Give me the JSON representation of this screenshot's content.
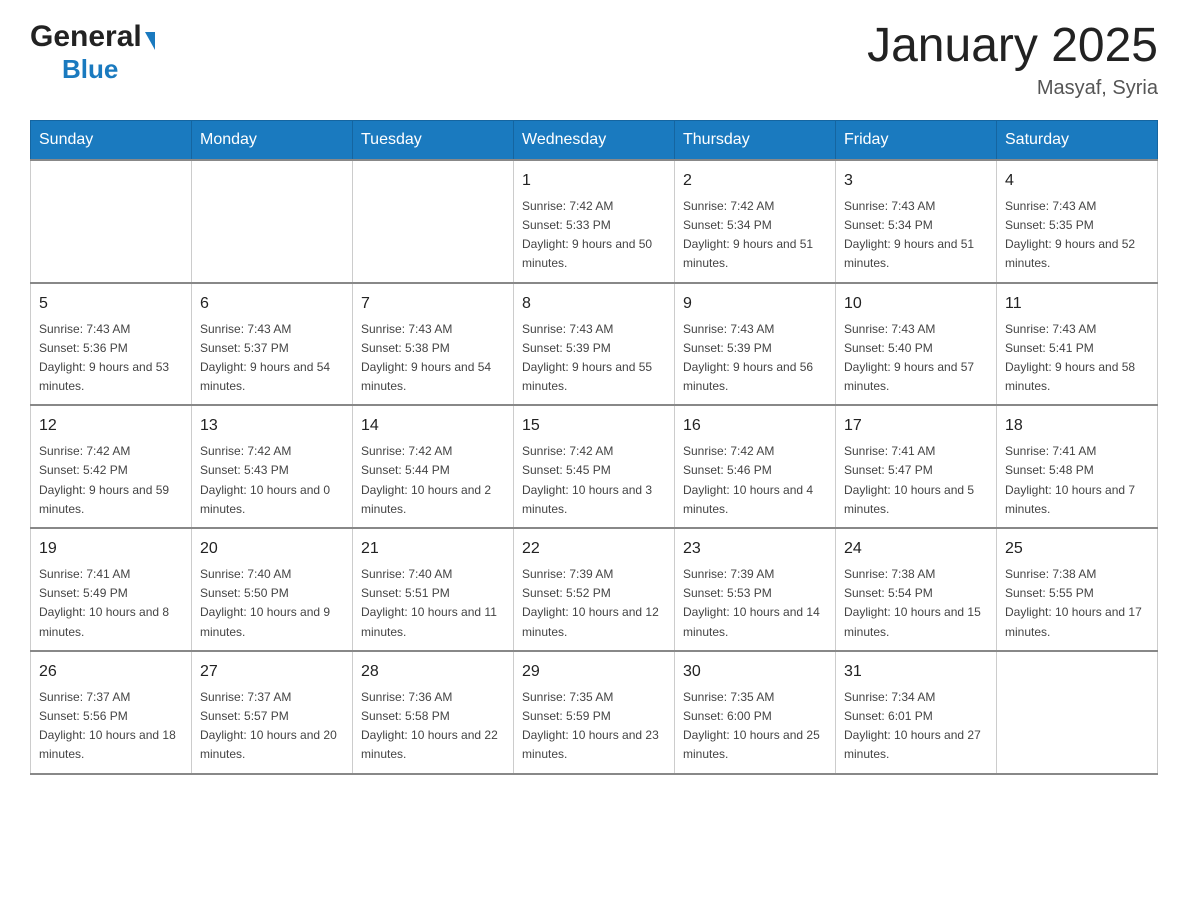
{
  "header": {
    "logo_general": "General",
    "logo_blue": "Blue",
    "month_title": "January 2025",
    "location": "Masyaf, Syria"
  },
  "days_of_week": [
    "Sunday",
    "Monday",
    "Tuesday",
    "Wednesday",
    "Thursday",
    "Friday",
    "Saturday"
  ],
  "weeks": [
    [
      {
        "day": "",
        "sunrise": "",
        "sunset": "",
        "daylight": ""
      },
      {
        "day": "",
        "sunrise": "",
        "sunset": "",
        "daylight": ""
      },
      {
        "day": "",
        "sunrise": "",
        "sunset": "",
        "daylight": ""
      },
      {
        "day": "1",
        "sunrise": "Sunrise: 7:42 AM",
        "sunset": "Sunset: 5:33 PM",
        "daylight": "Daylight: 9 hours and 50 minutes."
      },
      {
        "day": "2",
        "sunrise": "Sunrise: 7:42 AM",
        "sunset": "Sunset: 5:34 PM",
        "daylight": "Daylight: 9 hours and 51 minutes."
      },
      {
        "day": "3",
        "sunrise": "Sunrise: 7:43 AM",
        "sunset": "Sunset: 5:34 PM",
        "daylight": "Daylight: 9 hours and 51 minutes."
      },
      {
        "day": "4",
        "sunrise": "Sunrise: 7:43 AM",
        "sunset": "Sunset: 5:35 PM",
        "daylight": "Daylight: 9 hours and 52 minutes."
      }
    ],
    [
      {
        "day": "5",
        "sunrise": "Sunrise: 7:43 AM",
        "sunset": "Sunset: 5:36 PM",
        "daylight": "Daylight: 9 hours and 53 minutes."
      },
      {
        "day": "6",
        "sunrise": "Sunrise: 7:43 AM",
        "sunset": "Sunset: 5:37 PM",
        "daylight": "Daylight: 9 hours and 54 minutes."
      },
      {
        "day": "7",
        "sunrise": "Sunrise: 7:43 AM",
        "sunset": "Sunset: 5:38 PM",
        "daylight": "Daylight: 9 hours and 54 minutes."
      },
      {
        "day": "8",
        "sunrise": "Sunrise: 7:43 AM",
        "sunset": "Sunset: 5:39 PM",
        "daylight": "Daylight: 9 hours and 55 minutes."
      },
      {
        "day": "9",
        "sunrise": "Sunrise: 7:43 AM",
        "sunset": "Sunset: 5:39 PM",
        "daylight": "Daylight: 9 hours and 56 minutes."
      },
      {
        "day": "10",
        "sunrise": "Sunrise: 7:43 AM",
        "sunset": "Sunset: 5:40 PM",
        "daylight": "Daylight: 9 hours and 57 minutes."
      },
      {
        "day": "11",
        "sunrise": "Sunrise: 7:43 AM",
        "sunset": "Sunset: 5:41 PM",
        "daylight": "Daylight: 9 hours and 58 minutes."
      }
    ],
    [
      {
        "day": "12",
        "sunrise": "Sunrise: 7:42 AM",
        "sunset": "Sunset: 5:42 PM",
        "daylight": "Daylight: 9 hours and 59 minutes."
      },
      {
        "day": "13",
        "sunrise": "Sunrise: 7:42 AM",
        "sunset": "Sunset: 5:43 PM",
        "daylight": "Daylight: 10 hours and 0 minutes."
      },
      {
        "day": "14",
        "sunrise": "Sunrise: 7:42 AM",
        "sunset": "Sunset: 5:44 PM",
        "daylight": "Daylight: 10 hours and 2 minutes."
      },
      {
        "day": "15",
        "sunrise": "Sunrise: 7:42 AM",
        "sunset": "Sunset: 5:45 PM",
        "daylight": "Daylight: 10 hours and 3 minutes."
      },
      {
        "day": "16",
        "sunrise": "Sunrise: 7:42 AM",
        "sunset": "Sunset: 5:46 PM",
        "daylight": "Daylight: 10 hours and 4 minutes."
      },
      {
        "day": "17",
        "sunrise": "Sunrise: 7:41 AM",
        "sunset": "Sunset: 5:47 PM",
        "daylight": "Daylight: 10 hours and 5 minutes."
      },
      {
        "day": "18",
        "sunrise": "Sunrise: 7:41 AM",
        "sunset": "Sunset: 5:48 PM",
        "daylight": "Daylight: 10 hours and 7 minutes."
      }
    ],
    [
      {
        "day": "19",
        "sunrise": "Sunrise: 7:41 AM",
        "sunset": "Sunset: 5:49 PM",
        "daylight": "Daylight: 10 hours and 8 minutes."
      },
      {
        "day": "20",
        "sunrise": "Sunrise: 7:40 AM",
        "sunset": "Sunset: 5:50 PM",
        "daylight": "Daylight: 10 hours and 9 minutes."
      },
      {
        "day": "21",
        "sunrise": "Sunrise: 7:40 AM",
        "sunset": "Sunset: 5:51 PM",
        "daylight": "Daylight: 10 hours and 11 minutes."
      },
      {
        "day": "22",
        "sunrise": "Sunrise: 7:39 AM",
        "sunset": "Sunset: 5:52 PM",
        "daylight": "Daylight: 10 hours and 12 minutes."
      },
      {
        "day": "23",
        "sunrise": "Sunrise: 7:39 AM",
        "sunset": "Sunset: 5:53 PM",
        "daylight": "Daylight: 10 hours and 14 minutes."
      },
      {
        "day": "24",
        "sunrise": "Sunrise: 7:38 AM",
        "sunset": "Sunset: 5:54 PM",
        "daylight": "Daylight: 10 hours and 15 minutes."
      },
      {
        "day": "25",
        "sunrise": "Sunrise: 7:38 AM",
        "sunset": "Sunset: 5:55 PM",
        "daylight": "Daylight: 10 hours and 17 minutes."
      }
    ],
    [
      {
        "day": "26",
        "sunrise": "Sunrise: 7:37 AM",
        "sunset": "Sunset: 5:56 PM",
        "daylight": "Daylight: 10 hours and 18 minutes."
      },
      {
        "day": "27",
        "sunrise": "Sunrise: 7:37 AM",
        "sunset": "Sunset: 5:57 PM",
        "daylight": "Daylight: 10 hours and 20 minutes."
      },
      {
        "day": "28",
        "sunrise": "Sunrise: 7:36 AM",
        "sunset": "Sunset: 5:58 PM",
        "daylight": "Daylight: 10 hours and 22 minutes."
      },
      {
        "day": "29",
        "sunrise": "Sunrise: 7:35 AM",
        "sunset": "Sunset: 5:59 PM",
        "daylight": "Daylight: 10 hours and 23 minutes."
      },
      {
        "day": "30",
        "sunrise": "Sunrise: 7:35 AM",
        "sunset": "Sunset: 6:00 PM",
        "daylight": "Daylight: 10 hours and 25 minutes."
      },
      {
        "day": "31",
        "sunrise": "Sunrise: 7:34 AM",
        "sunset": "Sunset: 6:01 PM",
        "daylight": "Daylight: 10 hours and 27 minutes."
      },
      {
        "day": "",
        "sunrise": "",
        "sunset": "",
        "daylight": ""
      }
    ]
  ]
}
